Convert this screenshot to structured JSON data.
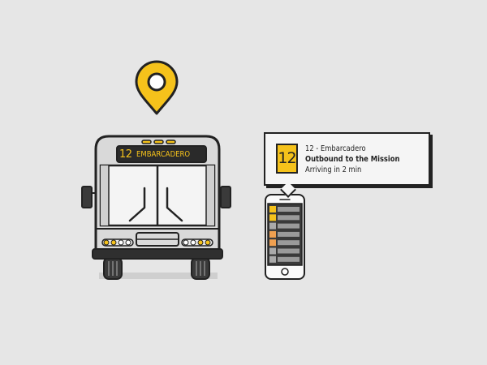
{
  "bus": {
    "route_number": "12",
    "destination": "EMBARCADERO"
  },
  "arrival_card": {
    "route_number": "12",
    "route_line": "12 - Embarcadero",
    "direction": "Outbound to the Mission",
    "arrival_text": "Arriving in 2 min"
  },
  "phone": {
    "list_item_colors": [
      "#f5c21b",
      "#f5c21b",
      "#aaaaaa",
      "#f0a050",
      "#f0a050",
      "#aaaaaa",
      "#aaaaaa"
    ]
  },
  "colors": {
    "accent_yellow": "#f5c21b",
    "outline": "#222222",
    "background": "#e6e6e6"
  },
  "icons": [
    "location-pin-icon",
    "bus-illustration",
    "smartphone-illustration"
  ]
}
